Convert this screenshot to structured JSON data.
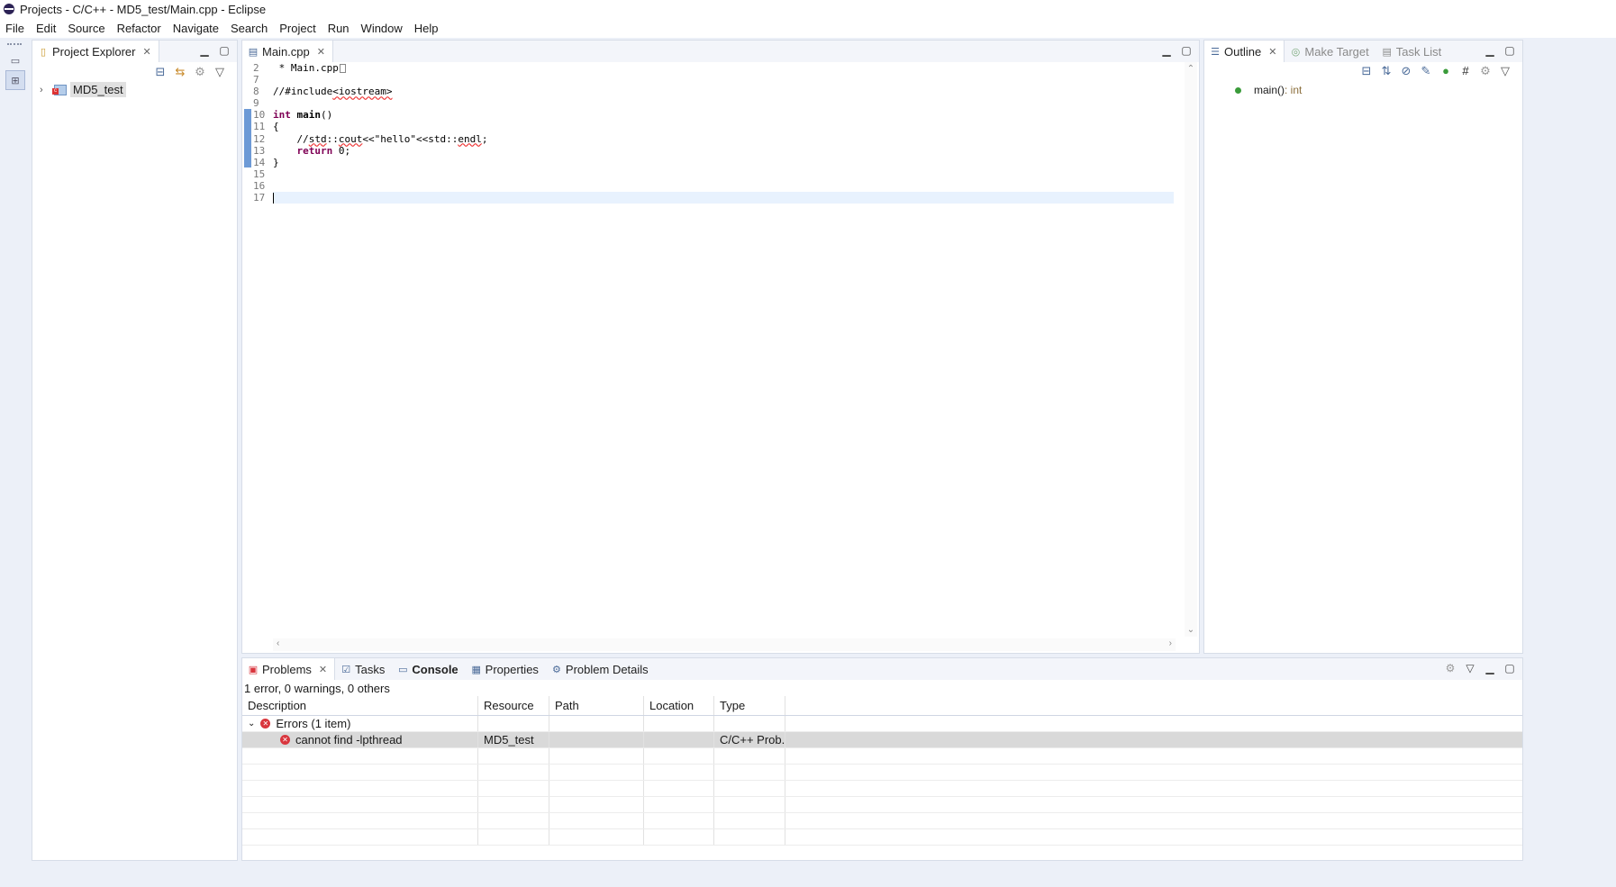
{
  "window": {
    "title": "Projects - C/C++ - MD5_test/Main.cpp - Eclipse"
  },
  "menu": [
    "File",
    "Edit",
    "Source",
    "Refactor",
    "Navigate",
    "Search",
    "Project",
    "Run",
    "Window",
    "Help"
  ],
  "project_explorer": {
    "tab_label": "Project Explorer",
    "items": [
      {
        "label": "MD5_test",
        "icon": "c-project-icon"
      }
    ]
  },
  "editor": {
    "tab_label": "Main.cpp",
    "line_numbers": [
      "2",
      "7",
      "8",
      "9",
      "10",
      "11",
      "12",
      "13",
      "14",
      "15",
      "16",
      "17"
    ],
    "lines": {
      "l2": " * Main.cpp",
      "l8_prefix": "//#include",
      "l8_header": "<iostream>",
      "l10_kw": "int",
      "l10_fn": "main",
      "l10_rest": "()",
      "l11": "{",
      "l12_prefix": "    //",
      "l12_std1": "std",
      "l12_sep1": "::",
      "l12_cout": "cout",
      "l12_op1": "<<",
      "l12_str": "\"hello\"",
      "l12_op2": "<<std::",
      "l12_endl": "endl",
      "l12_semi": ";",
      "l13_indent": "    ",
      "l13_kw": "return",
      "l13_rest": " 0;",
      "l14": "}"
    }
  },
  "outline": {
    "tabs": [
      "Outline",
      "Make Target",
      "Task List"
    ],
    "items": [
      {
        "name": "main()",
        "type": " : int"
      }
    ]
  },
  "problems": {
    "tabs": [
      "Problems",
      "Tasks",
      "Console",
      "Properties",
      "Problem Details"
    ],
    "summary": "1 error, 0 warnings, 0 others",
    "columns": [
      "Description",
      "Resource",
      "Path",
      "Location",
      "Type"
    ],
    "group": {
      "label": "Errors (1 item)"
    },
    "rows": [
      {
        "description": "cannot find -lpthread",
        "resource": "MD5_test",
        "path": "",
        "location": "",
        "type": "C/C++ Prob..."
      }
    ]
  },
  "colors": {
    "accent": "#6d9ad6",
    "error": "#d9363e",
    "keyword": "#7f0055",
    "comment": "#3f7f5f",
    "string": "#2a00ff"
  }
}
